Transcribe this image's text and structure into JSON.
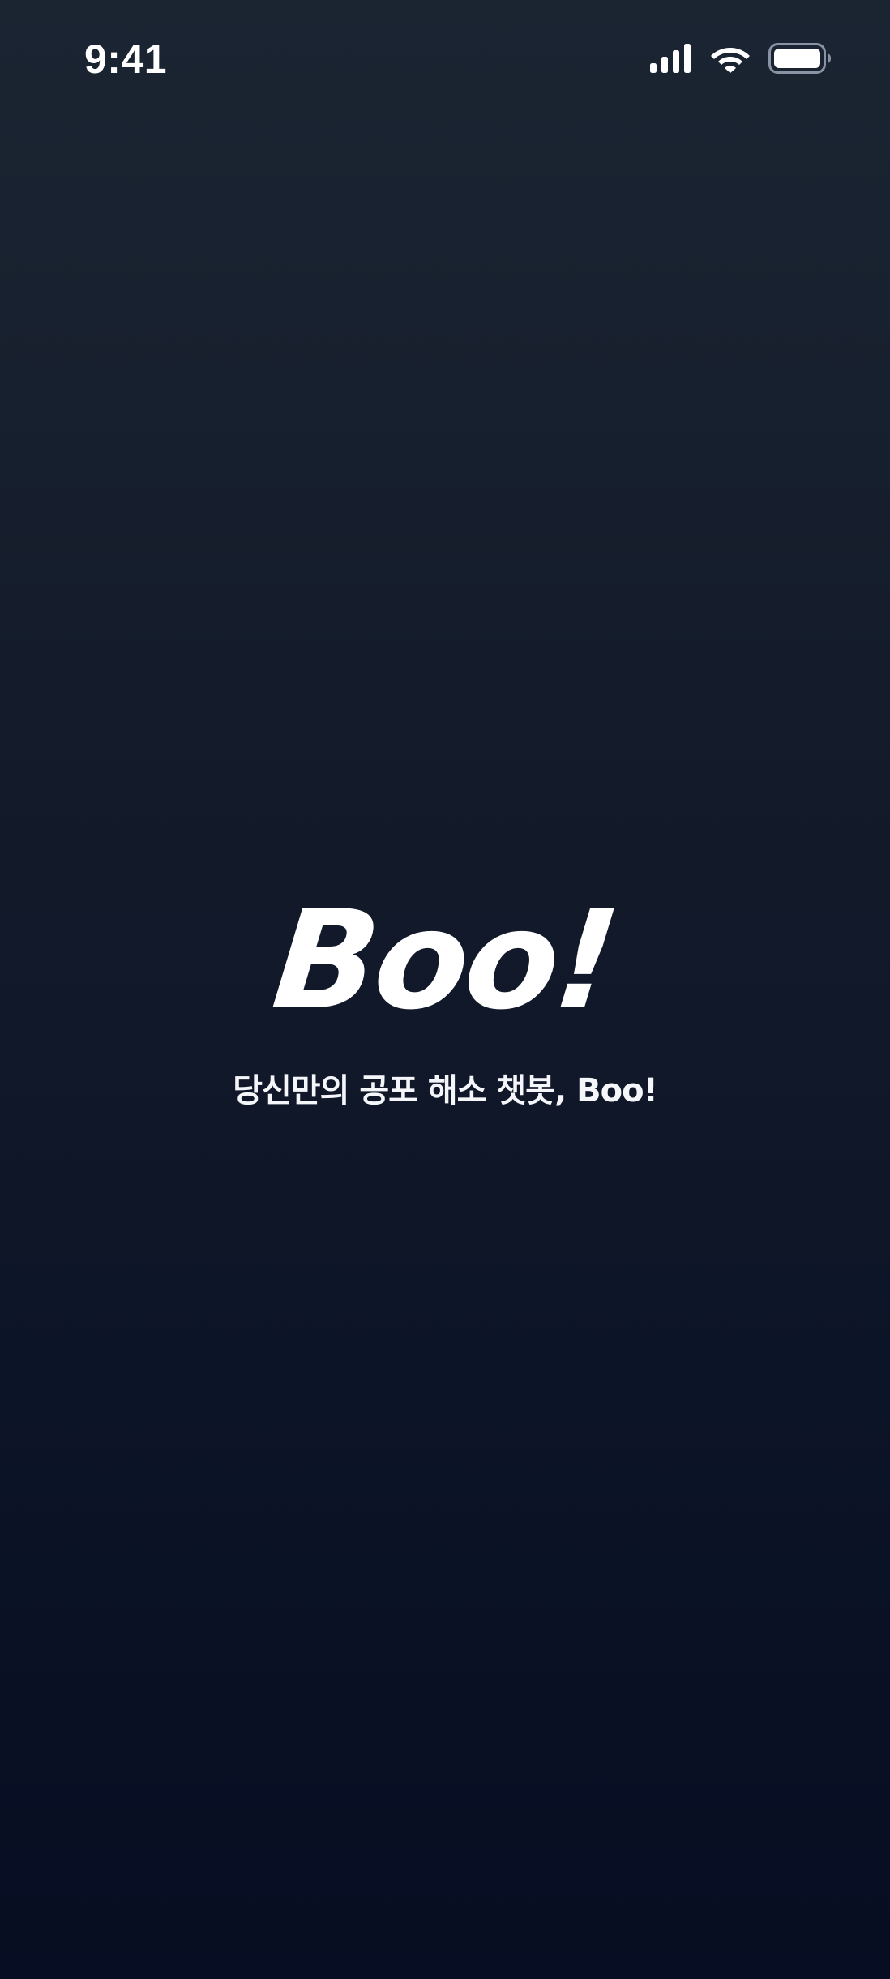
{
  "status_bar": {
    "time": "9:41",
    "icons": [
      "cellular-signal-icon",
      "wifi-icon",
      "battery-icon"
    ]
  },
  "splash": {
    "logo_text": "Boo!",
    "tagline": "당신만의 공포 해소 챗봇, Boo!"
  },
  "colors": {
    "background_top": "#1b2532",
    "background_bottom": "#070d22",
    "text": "#ffffff"
  }
}
